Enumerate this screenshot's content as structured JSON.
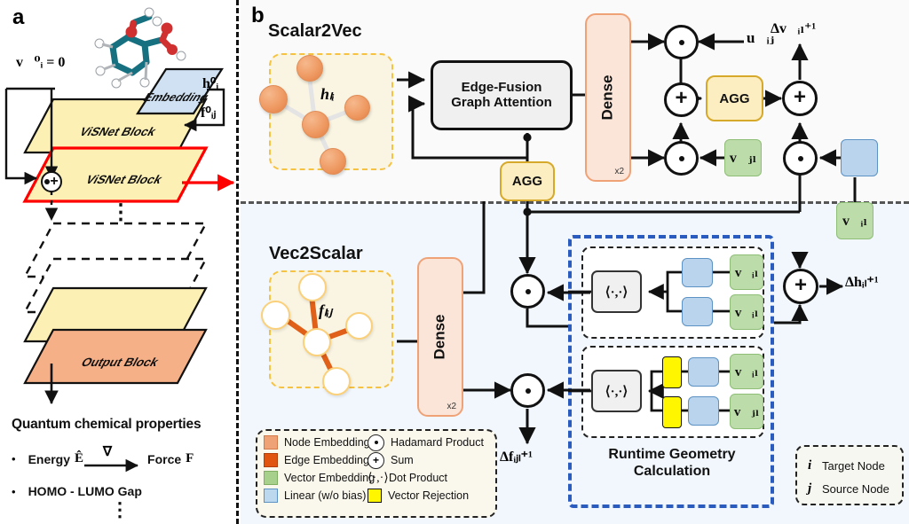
{
  "panels": {
    "a": {
      "letter": "a"
    },
    "b": {
      "letter": "b"
    }
  },
  "panel_a": {
    "v_zero_label": "v⃗⁰ᵢ = 0⃗",
    "h0_label": "h⁰ᵢ",
    "f0_label": "f⁰ᵢⱼ",
    "layers": [
      {
        "name": "embedding",
        "label": "Embedding"
      },
      {
        "name": "visnet-block-1",
        "label": "ViSNet Block"
      },
      {
        "name": "visnet-block-2",
        "label": "ViSNet Block"
      },
      {
        "name": "dashed-block-1",
        "label": ""
      },
      {
        "name": "dashed-block-2",
        "label": ""
      },
      {
        "name": "visnet-block-3",
        "label": ""
      },
      {
        "name": "output-block",
        "label": "Output Block"
      }
    ],
    "properties_title": "Quantum chemical properties",
    "properties": [
      {
        "prefix": "Energy",
        "symbol": "Ê",
        "arrow_label": "∇",
        "suffix": "Force",
        "suffix_symbol": "F⃗"
      },
      {
        "text": "HOMO - LUMO Gap"
      }
    ],
    "ellipsis": "⋮"
  },
  "panel_b": {
    "scalar2vec": {
      "title": "Scalar2Vec",
      "graph_label": "hₗᵢ"
    },
    "vec2scalar": {
      "title": "Vec2Scalar",
      "graph_label": "fₗᵢⱼ"
    },
    "edge_fusion": {
      "line1": "Edge-Fusion",
      "line2": "Graph Attention"
    },
    "agg_top": "AGG",
    "agg_mid": "AGG",
    "dense_top": {
      "label": "Dense",
      "repeat": "x2"
    },
    "dense_bottom": {
      "label": "Dense",
      "repeat": "x2"
    },
    "runtime_geometry": {
      "line1": "Runtime Geometry",
      "line2": "Calculation"
    },
    "dot_product_symbol": "⟨·,·⟩",
    "tensors": {
      "u_ij": "u⃗ᵢⱼ",
      "v_j_l": "v⃗ⱼₗ",
      "v_i_l": "v⃗ᵢₗ",
      "delta_v": "Δv⃗ᵢₗ⁺¹",
      "delta_h": "Δhᵢₗ⁺¹",
      "delta_f": "Δfᵢⱼₗ⁺¹"
    },
    "geometry_rows": [
      {
        "name": "angle-row",
        "vec_top": "v⃗ᵢₗ",
        "vec_bottom": "v⃗ᵢₗ",
        "has_rejection": false
      },
      {
        "name": "dihedral-row",
        "vec_top": "v⃗ᵢₗ",
        "vec_bottom": "v⃗ⱼₗ",
        "has_rejection": true
      }
    ],
    "legend": {
      "left": [
        {
          "name": "node-embedding",
          "swatch": "#f0a277",
          "label": "Node Embedding"
        },
        {
          "name": "edge-embedding",
          "swatch": "#e0540f",
          "label": "Edge Embedding"
        },
        {
          "name": "vector-embedding",
          "swatch": "#a8d08d",
          "label": "Vector Embedding"
        },
        {
          "name": "linear-no-bias",
          "swatch": "#bcd8ef",
          "label": "Linear (w/o bias)"
        }
      ],
      "right": [
        {
          "name": "hadamard-product",
          "glyph": "dot",
          "label": "Hadamard Product"
        },
        {
          "name": "sum",
          "glyph": "+",
          "label": "Sum"
        },
        {
          "name": "dot-product",
          "glyph": "⟨·,·⟩",
          "label": "Dot Product"
        },
        {
          "name": "vector-rejection",
          "swatch": "#fff600",
          "label": "Vector Rejection"
        }
      ]
    },
    "node_legend": [
      {
        "symbol": "i",
        "label": "Target Node"
      },
      {
        "symbol": "j",
        "label": "Source Node"
      }
    ]
  },
  "colors": {
    "node_embedding": "#f0a277",
    "edge_embedding": "#e0540f",
    "vector_embedding": "#a8d08d",
    "linear": "#bcd8ef",
    "vector_rejection": "#fff600",
    "agg": "#fdeec2",
    "highlight_red": "#ff0000",
    "runtime_blue": "#2a5cc0"
  }
}
